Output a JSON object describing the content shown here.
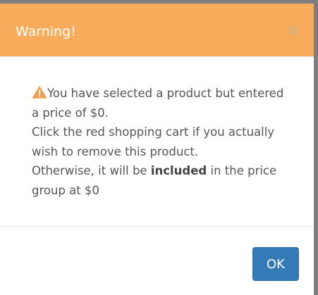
{
  "dialog": {
    "title": "Warning!",
    "close_symbol": "×",
    "message": {
      "icon": "warning-triangle-icon",
      "line1": "You have selected a product but entered a price of $0.",
      "line2": "Click the red shopping cart if you actually wish to remove this product.",
      "line3_before": "Otherwise, it will be ",
      "line3_bold": "included",
      "line3_after": " in the price group at $0"
    },
    "ok_label": "OK"
  },
  "colors": {
    "header_bg": "#f6ac5b",
    "ok_button_bg": "#337ab7",
    "warning_icon": "#f0a050",
    "body_text": "#555555"
  }
}
